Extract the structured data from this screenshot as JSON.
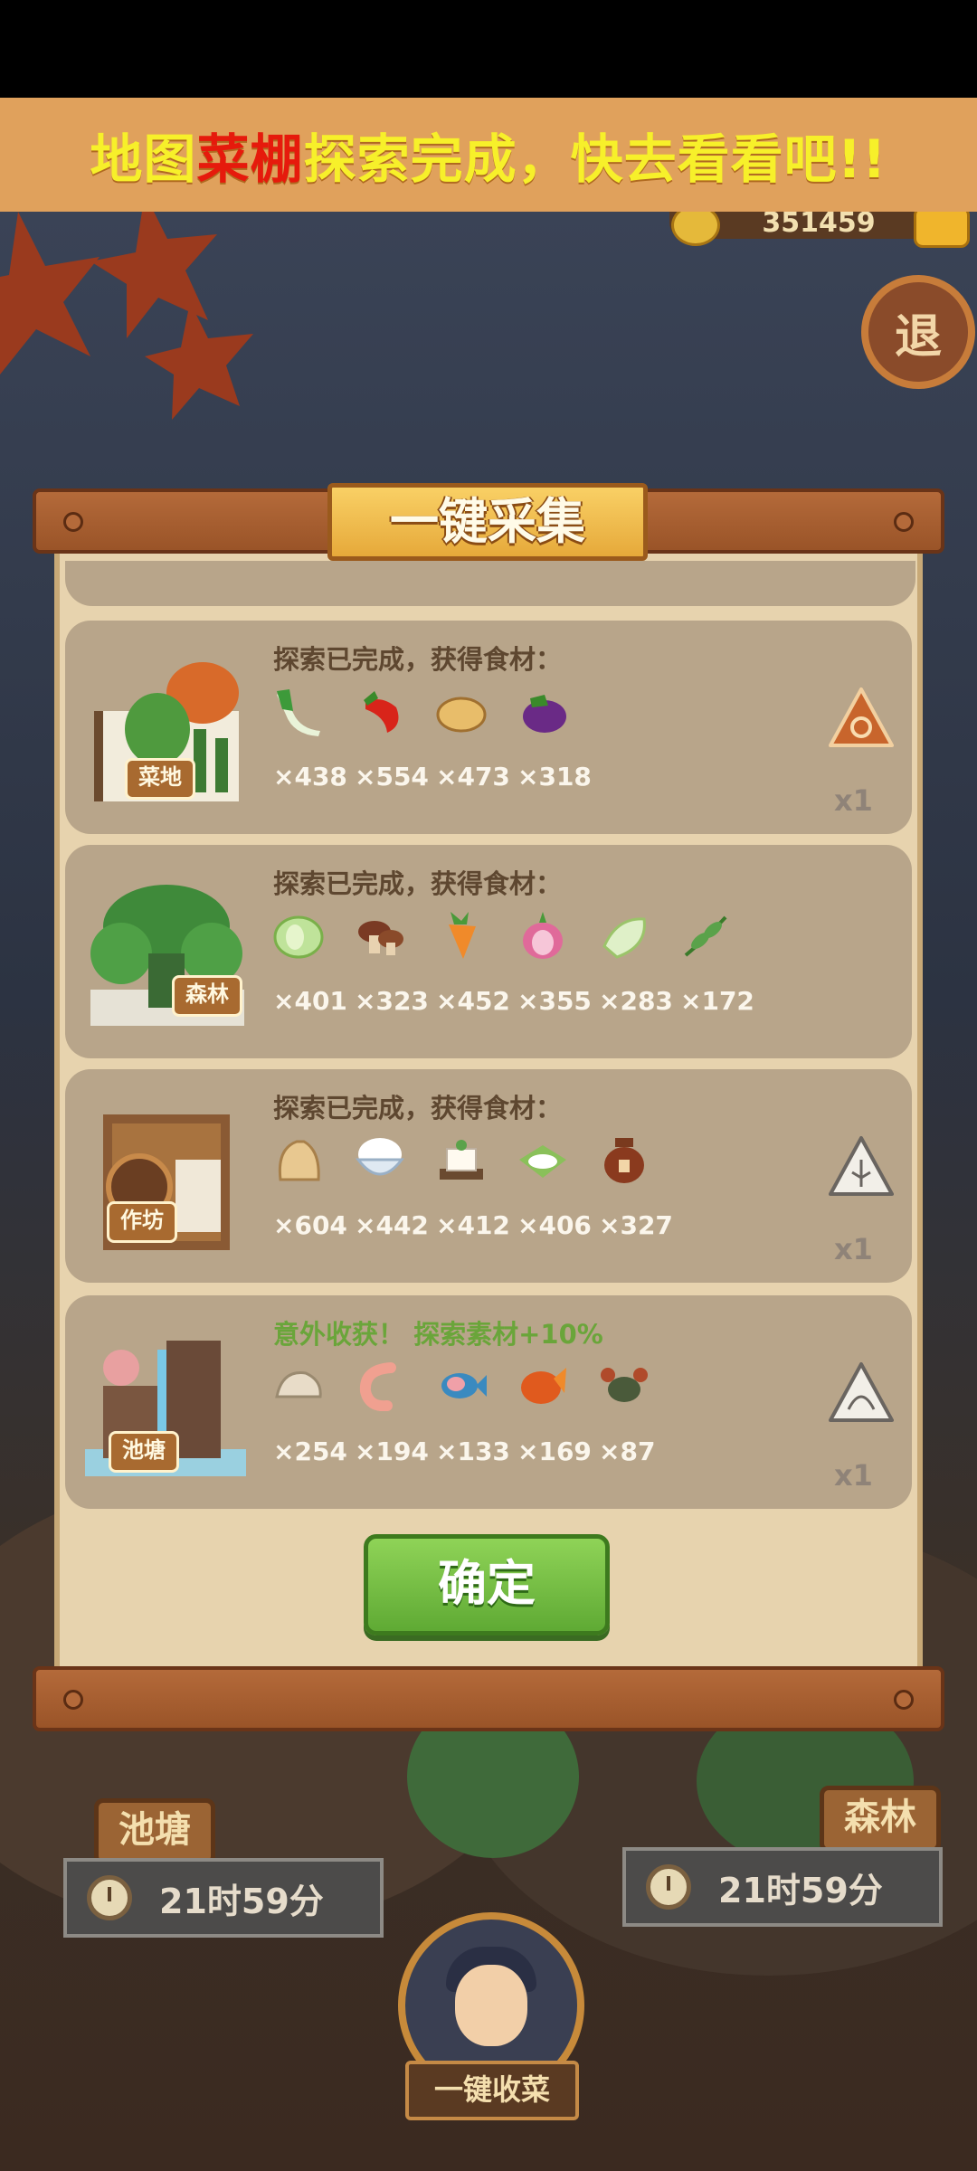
{
  "banner": {
    "prefix": "地图",
    "highlight": "菜棚",
    "suffix": "探索完成，快去看看吧!!"
  },
  "top_bar": {
    "coins": "351459",
    "exit_label": "退"
  },
  "dialog": {
    "title": "一键采集",
    "rows": [
      {
        "location": "菜地",
        "header": "探索已完成，获得食材：",
        "items": [
          {
            "icon": "leek-icon",
            "count": "×438"
          },
          {
            "icon": "chili-icon",
            "count": "×554"
          },
          {
            "icon": "potato-icon",
            "count": "×473"
          },
          {
            "icon": "eggplant-icon",
            "count": "×318"
          }
        ],
        "bonus_icon": "red-triangle-token-icon",
        "bonus_count": "x1"
      },
      {
        "location": "森林",
        "header": "探索已完成，获得食材：",
        "items": [
          {
            "icon": "cabbage-icon",
            "count": "×401"
          },
          {
            "icon": "mushroom-icon",
            "count": "×323"
          },
          {
            "icon": "carrot-icon",
            "count": "×452"
          },
          {
            "icon": "onion-icon",
            "count": "×355"
          },
          {
            "icon": "bamboo-shoot-icon",
            "count": "×283"
          },
          {
            "icon": "herb-icon",
            "count": "×172"
          }
        ],
        "bonus_icon": "",
        "bonus_count": ""
      },
      {
        "location": "作坊",
        "header": "探索已完成，获得食材：",
        "items": [
          {
            "icon": "flour-sack-icon",
            "count": "×604"
          },
          {
            "icon": "rice-bowl-icon",
            "count": "×442"
          },
          {
            "icon": "tofu-icon",
            "count": "×412"
          },
          {
            "icon": "sticky-rice-icon",
            "count": "×406"
          },
          {
            "icon": "wine-jar-icon",
            "count": "×327"
          }
        ],
        "bonus_icon": "white-leaf-token-icon",
        "bonus_count": "x1"
      },
      {
        "location": "池塘",
        "header": "意外收获！ 探索素材+10%",
        "items": [
          {
            "icon": "clam-icon",
            "count": "×254"
          },
          {
            "icon": "shrimp-icon",
            "count": "×194"
          },
          {
            "icon": "fish-icon",
            "count": "×133"
          },
          {
            "icon": "carp-icon",
            "count": "×169"
          },
          {
            "icon": "crab-icon",
            "count": "×87"
          }
        ],
        "bonus_icon": "white-shell-token-icon",
        "bonus_count": "x1"
      }
    ],
    "confirm_label": "确定"
  },
  "scene": {
    "pond_label": "池塘",
    "forest_label": "森林",
    "pond_timer": "21时59分",
    "forest_timer": "21时59分",
    "harvest_label": "一键收菜"
  }
}
